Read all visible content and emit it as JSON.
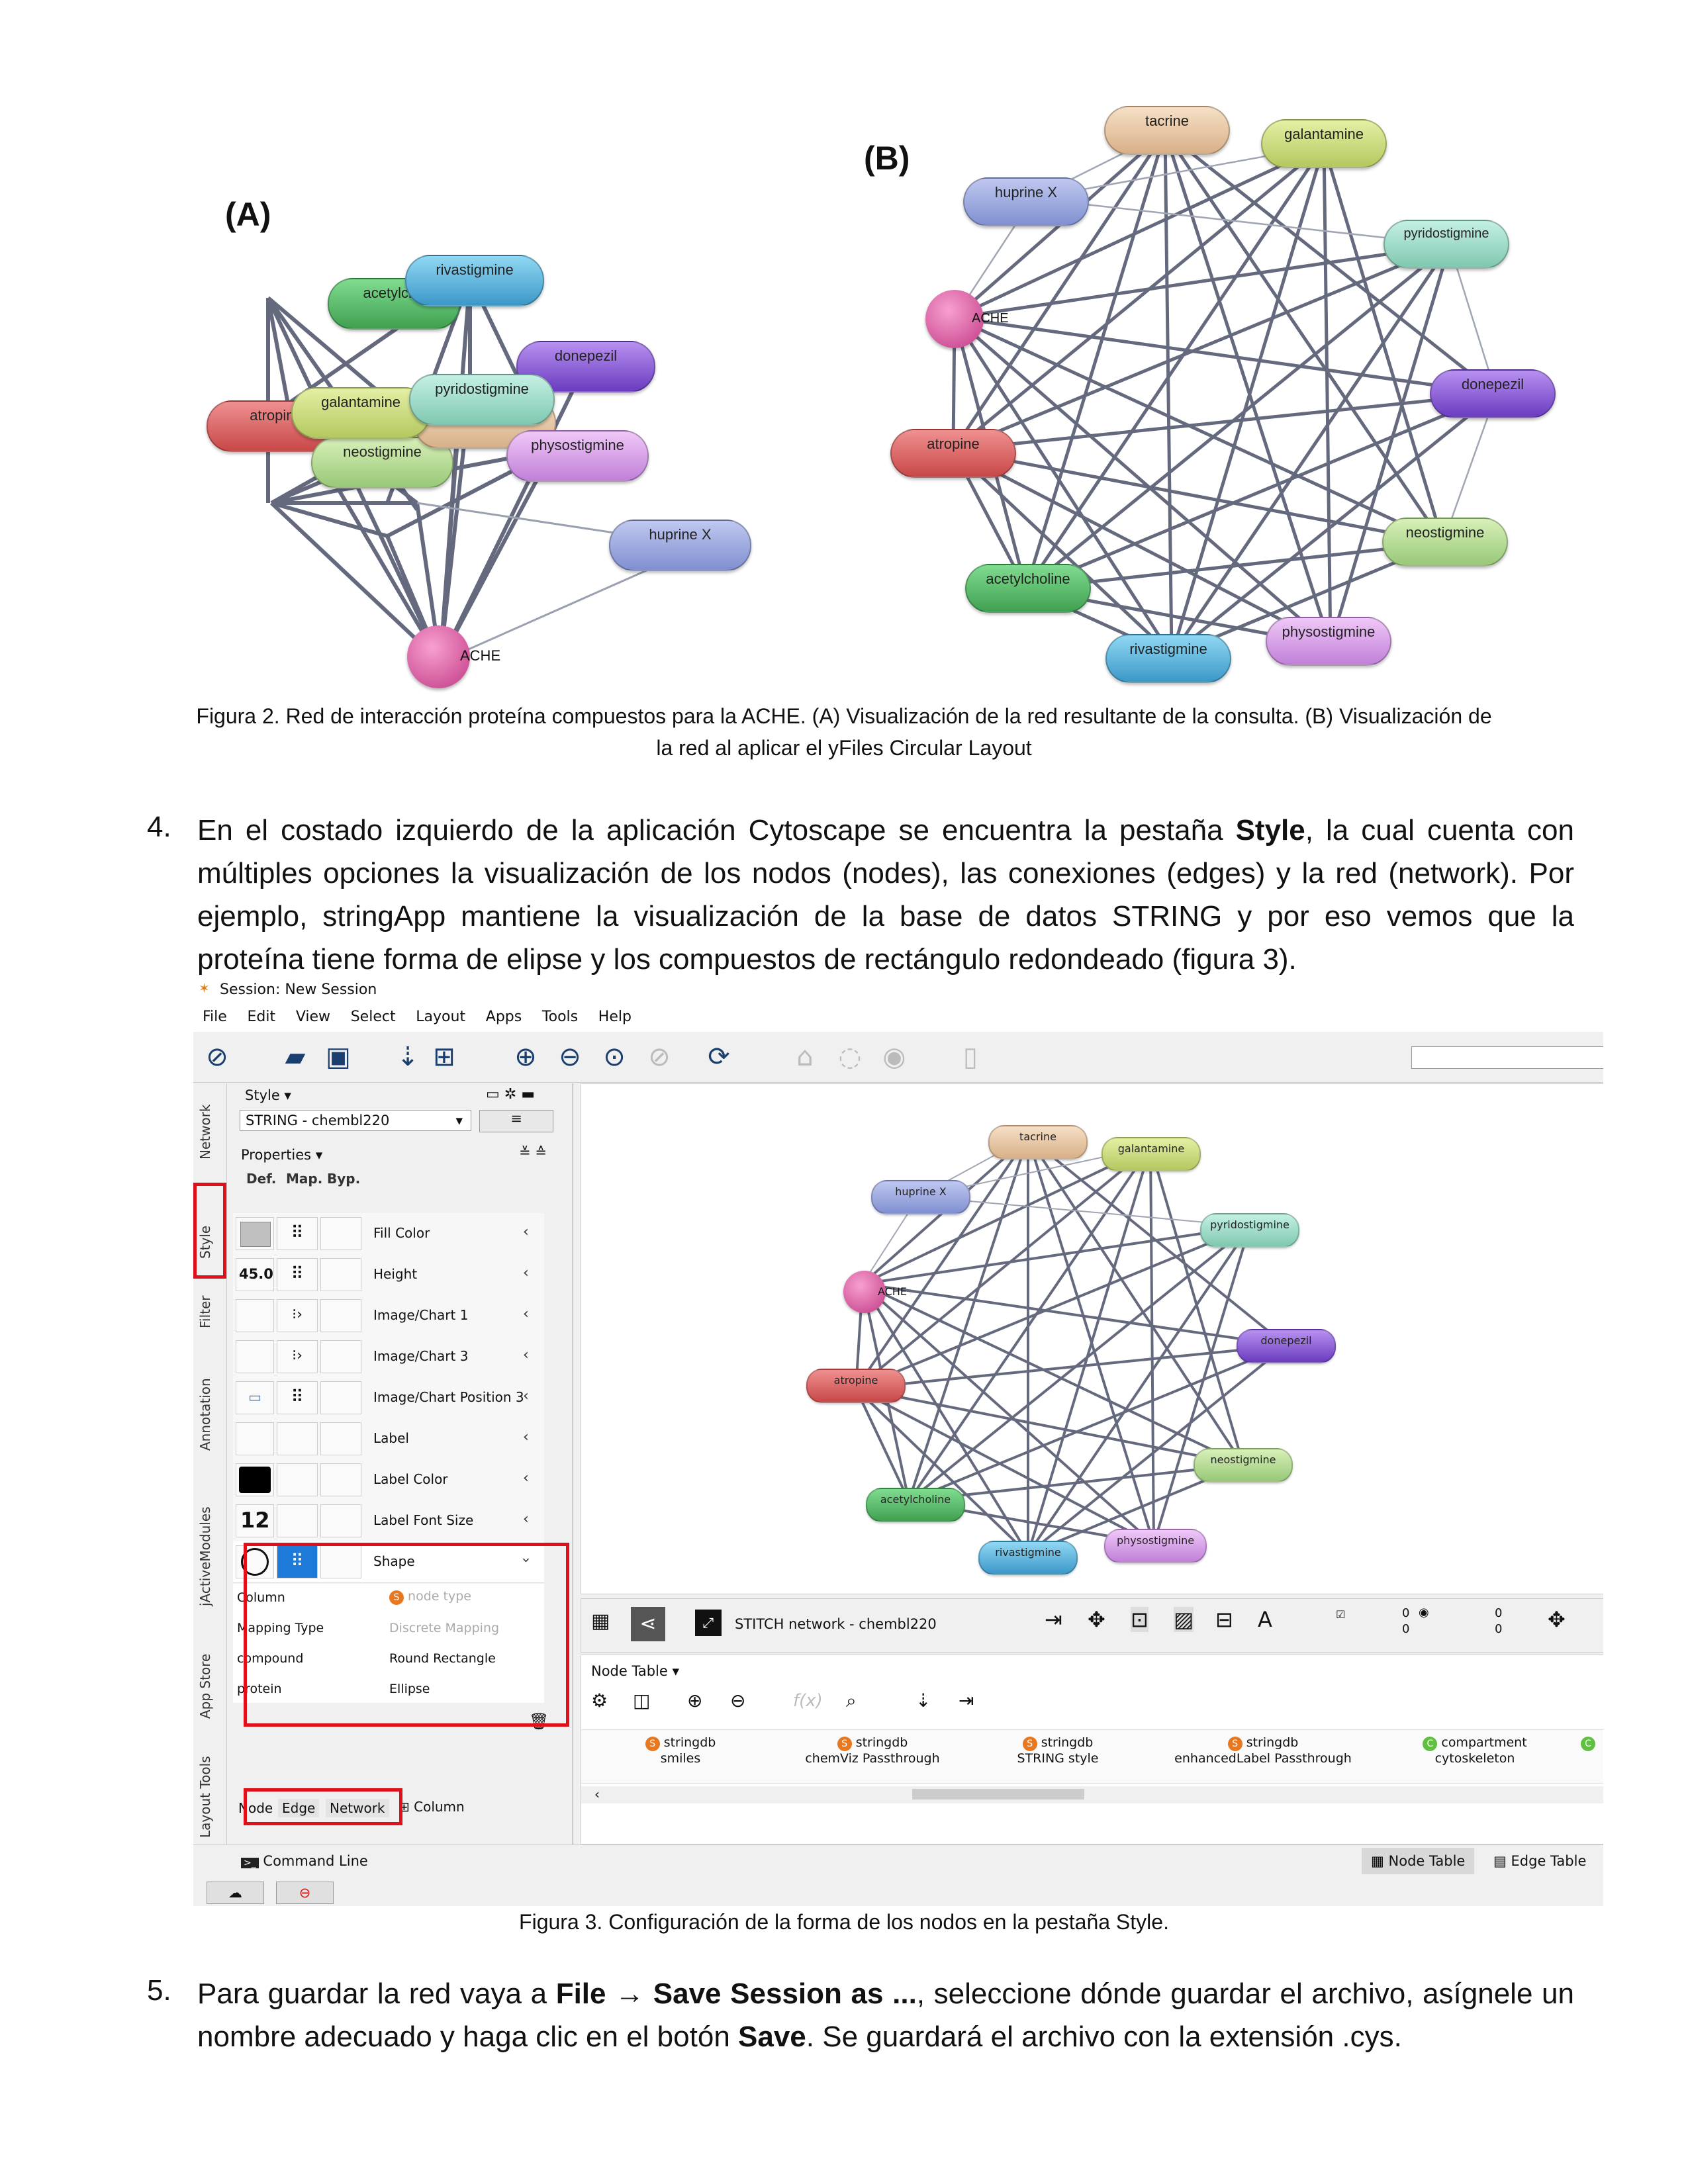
{
  "figure2": {
    "label_a": "(A)",
    "label_b": "(B)",
    "caption_line1": "Figura 2. Red de interacción proteína compuestos para la ACHE. (A) Visualización de la red resultante de la consulta. (B) Visualización de",
    "caption_line2": "la red al aplicar el yFiles Circular Layout",
    "nodes": {
      "acetylcholine": "acetylcholine",
      "acetylcho_trunc": "acetylcho",
      "rivastigmine": "rivastigmine",
      "donepezil": "donepezil",
      "galantamine": "galantamine",
      "pyridostigmine": "pyridostigmine",
      "physostigmine": "physostigmine",
      "tacrine": "tacrine",
      "atropine": "atropine",
      "neostigmine": "neostigmine",
      "huprine": "huprine X",
      "ache": "ACHE"
    },
    "node_colors": {
      "acetylcholine": "#5cc46c",
      "rivastigmine": "#5ab4dc",
      "donepezil": "#8a5ad8",
      "galantamine": "#c8dc78",
      "pyridostigmine": "#8cd8c8",
      "physostigmine": "#d89ce8",
      "tacrine": "#e8c8a8",
      "atropine": "#e07070",
      "neostigmine": "#b4dc94",
      "huprine": "#98a4dc",
      "ache": "#d85aa0"
    }
  },
  "step4": {
    "number": "4.",
    "text_before_bold": "En el costado izquierdo de la aplicación Cytoscape se encuentra la pestaña ",
    "bold": "Style",
    "text_after_bold": ", la cual cuenta con múltiples opciones la visualización de los nodos (nodes), las conexiones (edges) y la red (network). Por ejemplo, stringApp mantiene la visualización de la base de datos STRING y por eso vemos que la proteína tiene forma de elipse y los compuestos de rectángulo redondeado (figura 3)."
  },
  "cytoscape": {
    "window_title": "Session: New Session",
    "menu": [
      "File",
      "Edit",
      "View",
      "Select",
      "Layout",
      "Apps",
      "Tools",
      "Help"
    ],
    "side_tabs": [
      "Network",
      "Style",
      "Filter",
      "Annotation",
      "jActiveModules",
      "App Store",
      "Layout Tools"
    ],
    "style_panel": {
      "header": "Style ▾",
      "style_name": "STRING - chembl220",
      "properties": "Properties ▾",
      "col_def": "Def.",
      "col_map": "Map.",
      "col_byp": "Byp.",
      "rows": [
        {
          "label": "Fill Color",
          "def": ""
        },
        {
          "label": "Height",
          "def": "45.0"
        },
        {
          "label": "Image/Chart 1",
          "def": ""
        },
        {
          "label": "Image/Chart 3",
          "def": ""
        },
        {
          "label": "Image/Chart Position 3",
          "def": ""
        },
        {
          "label": "Label",
          "def": ""
        },
        {
          "label": "Label Color",
          "def": ""
        },
        {
          "label": "Label Font Size",
          "def": "12"
        },
        {
          "label": "Shape",
          "def": ""
        }
      ],
      "mapping": {
        "column_label": "Column",
        "column_value": "node type",
        "type_label": "Mapping Type",
        "type_value": "Discrete Mapping",
        "k1": "compound",
        "v1": "Round Rectangle",
        "k2": "protein",
        "v2": "Ellipse"
      },
      "bottom_tabs": [
        "Node",
        "Edge",
        "Network"
      ],
      "column_button": "Column"
    },
    "network_title": "STITCH network - chembl220",
    "counts": {
      "a": "0",
      "b": "0",
      "c": "0",
      "d": "0"
    },
    "node_table": {
      "title": "Node Table ▾",
      "columns": [
        {
          "ns": "stringdb",
          "name": "smiles"
        },
        {
          "ns": "stringdb",
          "name": "chemViz Passthrough"
        },
        {
          "ns": "stringdb",
          "name": "STRING style"
        },
        {
          "ns": "stringdb",
          "name": "enhancedLabel Passthrough"
        },
        {
          "ns": "compartment",
          "name": "cytoskeleton"
        }
      ]
    },
    "command_line": "Command Line",
    "tab_node_table": "Node Table",
    "tab_edge_table": "Edge Table"
  },
  "figure3": {
    "caption": "Figura 3. Configuración de la forma de los nodos en la pestaña Style."
  },
  "step5": {
    "number": "5.",
    "t1": "Para guardar la red vaya a ",
    "b1": "File",
    "arrow": " → ",
    "b2": "Save Session as ...",
    "t2": ", seleccione dónde guardar el archivo, asígnele un nombre adecuado y haga clic en el botón ",
    "b3": "Save",
    "t3": ". Se guardará el archivo con la extensión .cys."
  }
}
